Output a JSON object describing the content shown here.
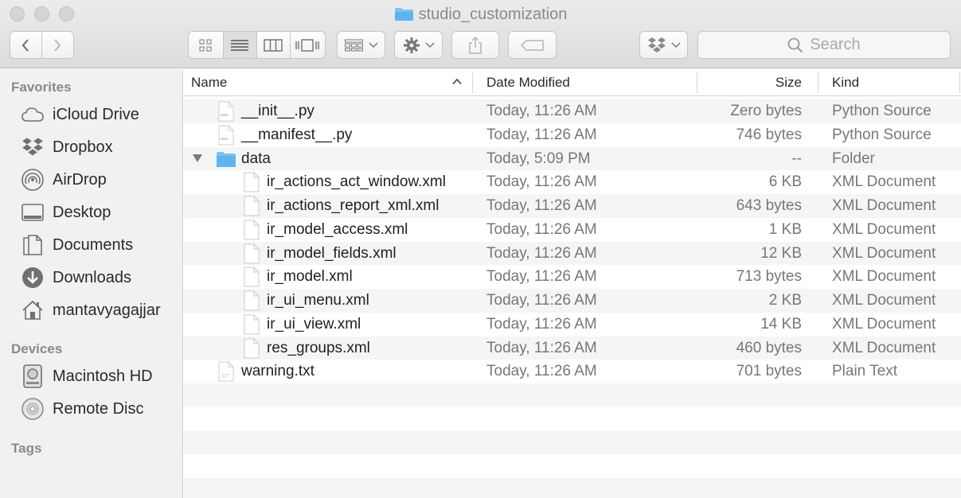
{
  "window": {
    "title": "studio_customization"
  },
  "toolbar": {
    "back": "back",
    "forward": "forward",
    "search_placeholder": "Search"
  },
  "sidebar": {
    "favorites_heading": "Favorites",
    "favorites": [
      {
        "label": "iCloud Drive",
        "icon": "cloud-icon"
      },
      {
        "label": "Dropbox",
        "icon": "dropbox-icon"
      },
      {
        "label": "AirDrop",
        "icon": "airdrop-icon"
      },
      {
        "label": "Desktop",
        "icon": "desktop-icon"
      },
      {
        "label": "Documents",
        "icon": "documents-icon"
      },
      {
        "label": "Downloads",
        "icon": "downloads-icon"
      },
      {
        "label": "mantavyagajjar",
        "icon": "home-icon"
      }
    ],
    "devices_heading": "Devices",
    "devices": [
      {
        "label": "Macintosh HD",
        "icon": "hard-drive-icon"
      },
      {
        "label": "Remote Disc",
        "icon": "disc-icon"
      }
    ],
    "tags_heading": "Tags"
  },
  "columns": {
    "name": "Name",
    "date": "Date Modified",
    "size": "Size",
    "kind": "Kind"
  },
  "files": [
    {
      "name": "__init__.py",
      "date": "Today, 11:26 AM",
      "size": "Zero bytes",
      "kind": "Python Source"
    },
    {
      "name": "__manifest__.py",
      "date": "Today, 11:26 AM",
      "size": "746 bytes",
      "kind": "Python Source"
    },
    {
      "name": "data",
      "date": "Today, 5:09 PM",
      "size": "--",
      "kind": "Folder"
    },
    {
      "name": "ir_actions_act_window.xml",
      "date": "Today, 11:26 AM",
      "size": "6 KB",
      "kind": "XML Document"
    },
    {
      "name": "ir_actions_report_xml.xml",
      "date": "Today, 11:26 AM",
      "size": "643 bytes",
      "kind": "XML Document"
    },
    {
      "name": "ir_model_access.xml",
      "date": "Today, 11:26 AM",
      "size": "1 KB",
      "kind": "XML Document"
    },
    {
      "name": "ir_model_fields.xml",
      "date": "Today, 11:26 AM",
      "size": "12 KB",
      "kind": "XML Document"
    },
    {
      "name": "ir_model.xml",
      "date": "Today, 11:26 AM",
      "size": "713 bytes",
      "kind": "XML Document"
    },
    {
      "name": "ir_ui_menu.xml",
      "date": "Today, 11:26 AM",
      "size": "2 KB",
      "kind": "XML Document"
    },
    {
      "name": "ir_ui_view.xml",
      "date": "Today, 11:26 AM",
      "size": "14 KB",
      "kind": "XML Document"
    },
    {
      "name": "res_groups.xml",
      "date": "Today, 11:26 AM",
      "size": "460 bytes",
      "kind": "XML Document"
    },
    {
      "name": "warning.txt",
      "date": "Today, 11:26 AM",
      "size": "701 bytes",
      "kind": "Plain Text"
    }
  ],
  "colors": {
    "folder_blue": "#5fb4f0",
    "sidebar_bg": "#f1f1f1",
    "row_alt": "#f4f5f5"
  }
}
